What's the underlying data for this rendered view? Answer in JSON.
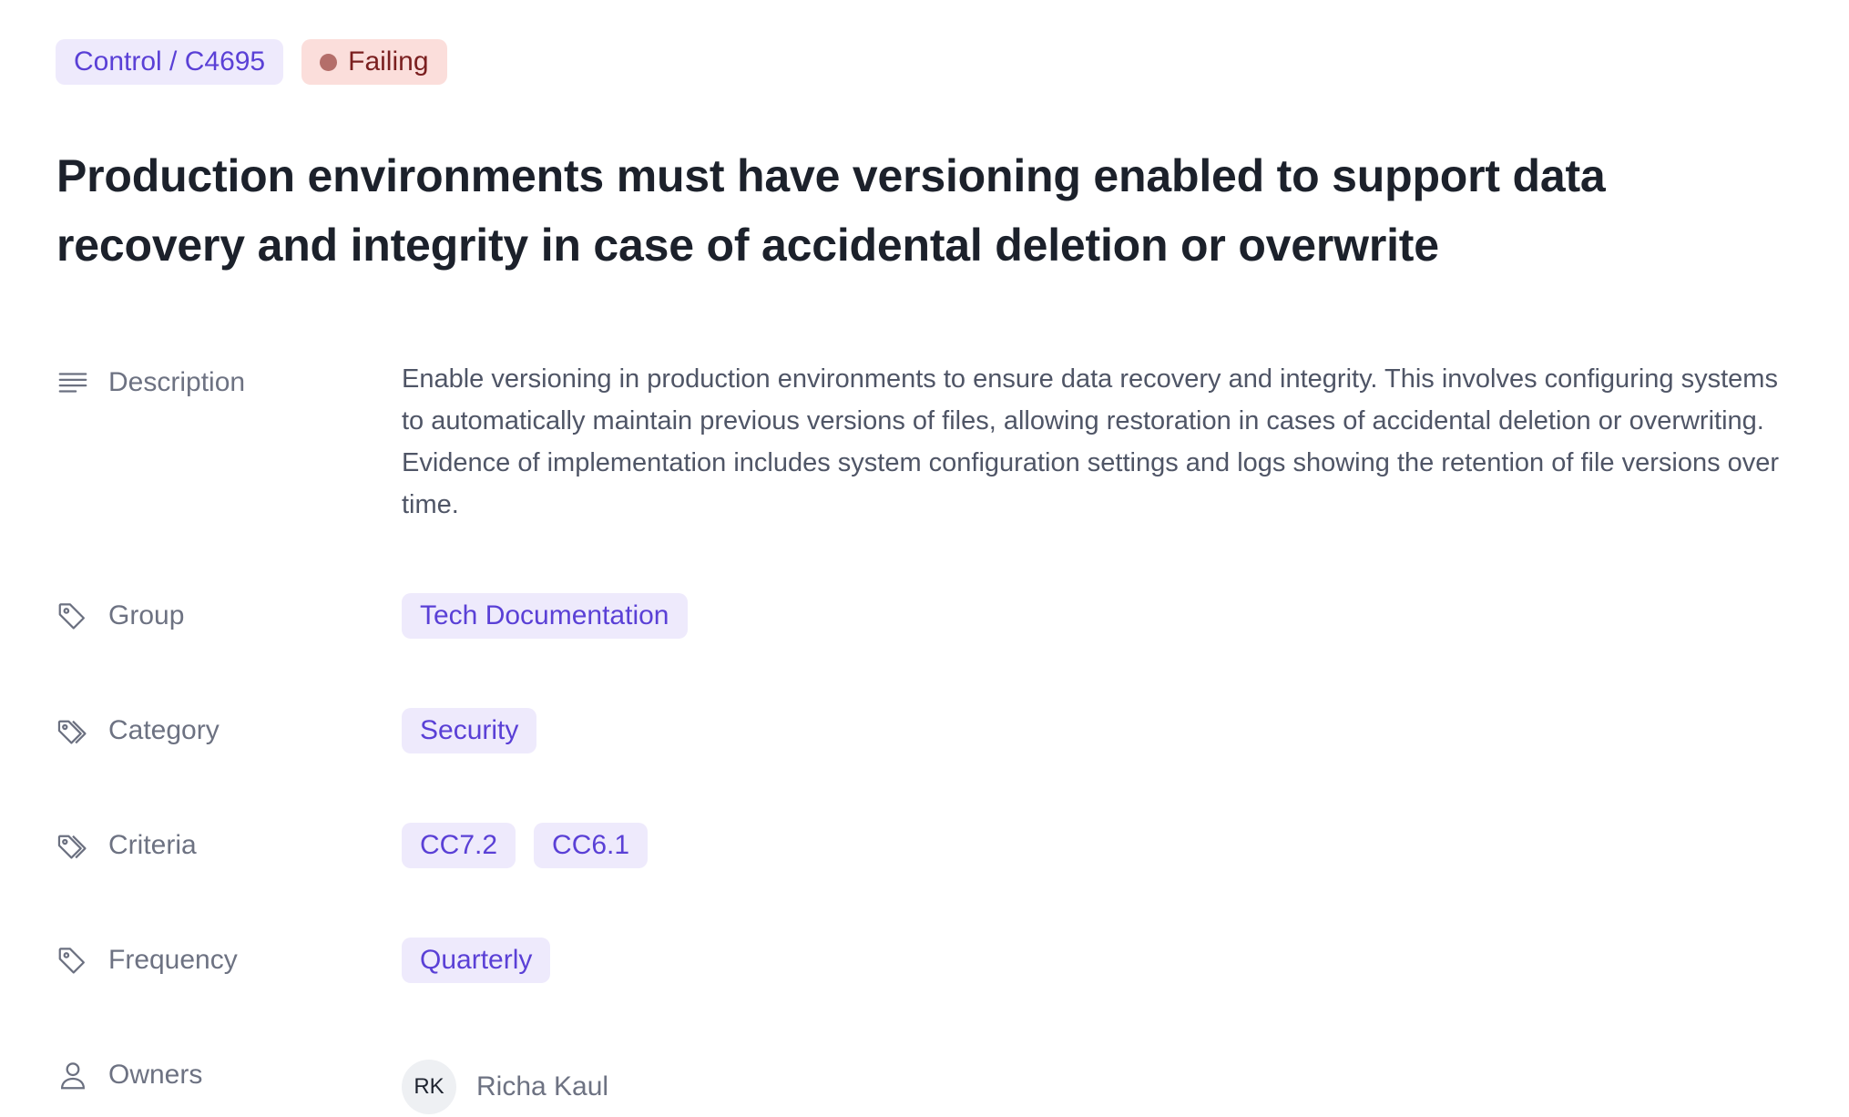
{
  "header": {
    "control_id_label": "Control / C4695",
    "status_label": "Failing",
    "status_color": "#b46e6a",
    "accent_color": "#5a40d6"
  },
  "title": "Production environments must have versioning enabled to support data recovery and integrity in case of accidental deletion or overwrite",
  "properties": {
    "description": {
      "label": "Description",
      "icon": "text-lines-icon",
      "value": "Enable versioning in production environments to ensure data recovery and integrity. This involves configuring systems to automatically maintain previous versions of files, allowing restoration in cases of accidental deletion or overwriting. Evidence of implementation includes system configuration settings and logs showing the retention of file versions over time."
    },
    "group": {
      "label": "Group",
      "icon": "tag-icon",
      "tags": [
        "Tech Documentation"
      ]
    },
    "category": {
      "label": "Category",
      "icon": "tags-icon",
      "tags": [
        "Security"
      ]
    },
    "criteria": {
      "label": "Criteria",
      "icon": "tags-icon",
      "tags": [
        "CC7.2",
        "CC6.1"
      ]
    },
    "frequency": {
      "label": "Frequency",
      "icon": "tag-icon",
      "tags": [
        "Quarterly"
      ]
    },
    "owners": {
      "label": "Owners",
      "icon": "user-icon",
      "people": [
        {
          "initials": "RK",
          "name": "Richa Kaul"
        }
      ]
    }
  }
}
